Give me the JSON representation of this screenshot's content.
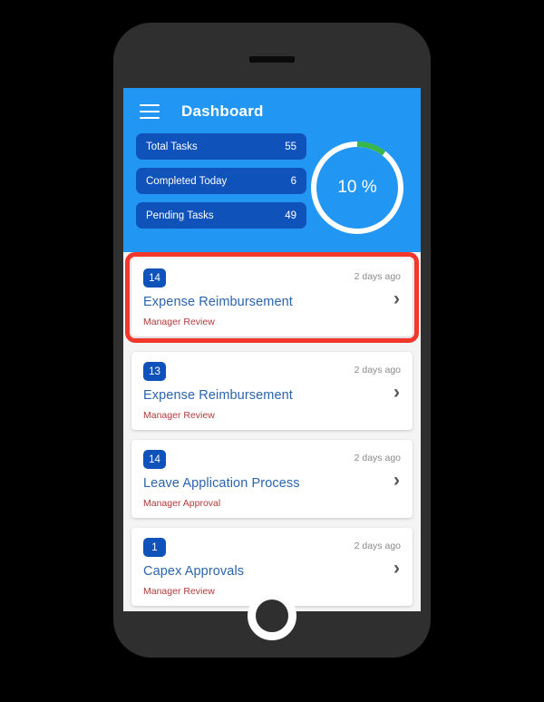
{
  "device": {
    "name": "smartphone-mockup",
    "speaker_icon": "speaker-slot",
    "home_icon": "home-button"
  },
  "colors": {
    "header_blue": "#2196f3",
    "pill_blue": "#0f52ba",
    "badge_blue": "#0f52ba",
    "title_blue": "#2a64ad",
    "status_red": "#b23a3a",
    "highlight_red": "#f4372b",
    "progress_green": "#39b54a",
    "track_white": "#ffffff",
    "screen_bg": "#f4f4f5",
    "frame_gray": "#2f2f2f"
  },
  "header": {
    "menu_icon": "hamburger-menu-icon",
    "title": "Dashboard",
    "stats": [
      {
        "label": "Total Tasks",
        "value": "55"
      },
      {
        "label": "Completed Today",
        "value": "6"
      },
      {
        "label": "Pending Tasks",
        "value": "49"
      }
    ],
    "progress": {
      "label": "10 %",
      "percent": 10.5,
      "start_angle_deg": 0
    }
  },
  "task_list": {
    "chevron_icon": "chevron-right-icon",
    "items": [
      {
        "count": "14",
        "timestamp": "2 days ago",
        "title": "Expense Reimbursement",
        "status": "Manager Review",
        "highlighted": true
      },
      {
        "count": "13",
        "timestamp": "2 days ago",
        "title": "Expense Reimbursement",
        "status": "Manager Review",
        "highlighted": false
      },
      {
        "count": "14",
        "timestamp": "2 days ago",
        "title": "Leave Application Process",
        "status": "Manager Approval",
        "highlighted": false
      },
      {
        "count": "1",
        "timestamp": "2 days ago",
        "title": "Capex Approvals",
        "status": "Manager Review",
        "highlighted": false
      }
    ]
  }
}
